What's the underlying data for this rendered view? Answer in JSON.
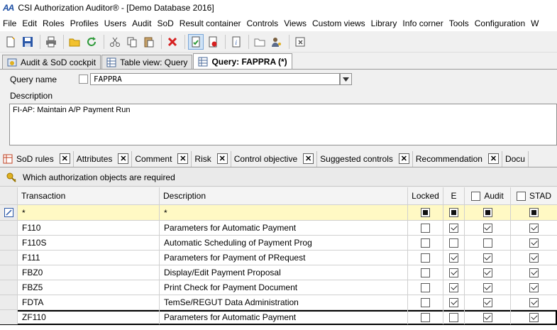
{
  "window": {
    "logo": "AA",
    "title": "CSI Authorization Auditor® - [Demo Database 2016]"
  },
  "menu": [
    "File",
    "Edit",
    "Roles",
    "Profiles",
    "Users",
    "Audit",
    "SoD",
    "Result container",
    "Controls",
    "Views",
    "Custom views",
    "Library",
    "Info corner",
    "Tools",
    "Configuration",
    "W"
  ],
  "toolbar_icons": [
    "new-icon",
    "save-icon",
    "print-icon",
    "open-folder-icon",
    "refresh-icon",
    "cut-icon",
    "copy-icon",
    "paste-icon",
    "delete-icon",
    "check-document-icon",
    "cancel-document-icon",
    "info-document-icon",
    "folder-icon",
    "user-key-icon",
    "exit-icon"
  ],
  "tabs": [
    {
      "label": "Audit & SoD cockpit",
      "icon": "cockpit-icon"
    },
    {
      "label": "Table view: Query",
      "icon": "table-icon"
    },
    {
      "label": "Query: FAPPRA (*)",
      "icon": "table-icon",
      "active": true
    }
  ],
  "form": {
    "query_name_label": "Query name",
    "query_name_value": "FAPPRA",
    "description_label": "Description",
    "description_value": "FI-AP: Maintain A/P Payment Run"
  },
  "subtabs": [
    "SoD rules",
    "Attributes",
    "Comment",
    "Risk",
    "Control objective",
    "Suggested controls",
    "Recommendation",
    "Docu"
  ],
  "infobar": {
    "text": "Which authorization objects are required",
    "icon": "key-icon"
  },
  "grid": {
    "headers": {
      "transaction": "Transaction",
      "description": "Description",
      "locked": "Locked",
      "e": "E",
      "audit": "Audit",
      "stad": "STAD"
    },
    "filter": {
      "transaction": "*",
      "description": "*"
    },
    "rows": [
      {
        "transaction": "F110",
        "description": "Parameters for Automatic Payment",
        "locked": false,
        "e": true,
        "audit": true,
        "stad": true
      },
      {
        "transaction": "F110S",
        "description": "Automatic Scheduling of Payment Prog",
        "locked": false,
        "e": false,
        "audit": false,
        "stad": true
      },
      {
        "transaction": "F111",
        "description": "Parameters for Payment of PRequest",
        "locked": false,
        "e": true,
        "audit": true,
        "stad": true
      },
      {
        "transaction": "FBZ0",
        "description": "Display/Edit Payment Proposal",
        "locked": false,
        "e": true,
        "audit": true,
        "stad": true
      },
      {
        "transaction": "FBZ5",
        "description": "Print Check for Payment Document",
        "locked": false,
        "e": true,
        "audit": true,
        "stad": true
      },
      {
        "transaction": "FDTA",
        "description": "TemSe/REGUT Data Administration",
        "locked": false,
        "e": true,
        "audit": true,
        "stad": true
      },
      {
        "transaction": "ZF110",
        "description": "Parameters for Automatic Payment",
        "locked": false,
        "e": false,
        "audit": true,
        "stad": true,
        "selected": true
      }
    ]
  }
}
